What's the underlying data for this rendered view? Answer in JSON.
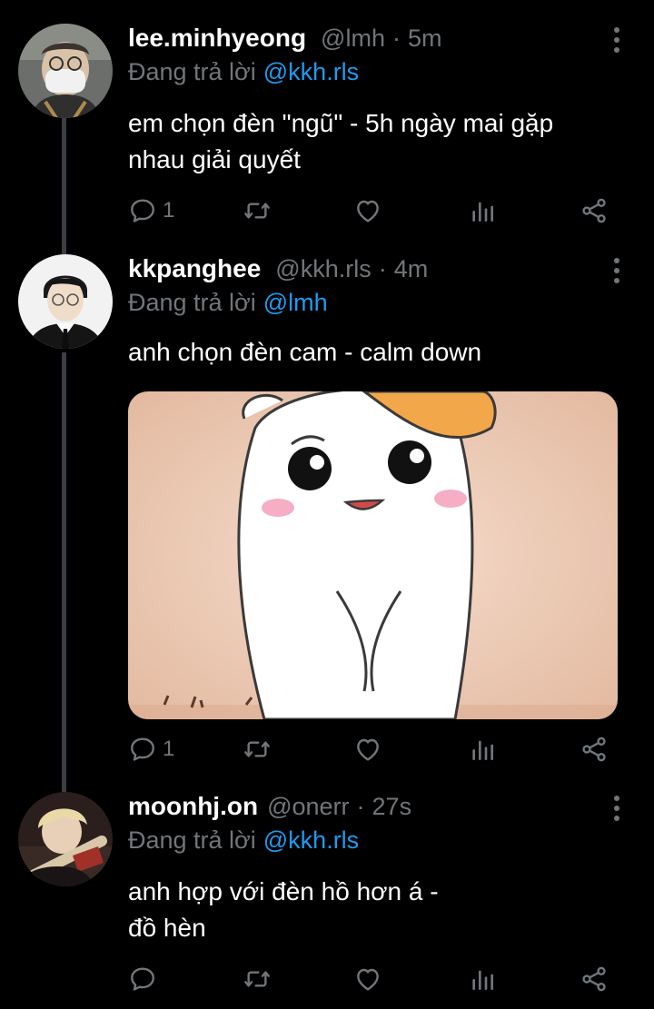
{
  "theme": {
    "background": "#000000",
    "accent": "#1d9bf0",
    "muted": "#71767b",
    "thread_line": "#3b3f44"
  },
  "tweets": [
    {
      "display_name": "lee.minhyeong",
      "handle": "@lmh",
      "separator": "·",
      "time": "5m",
      "reply_prefix": "Đang trả lời",
      "reply_to": "@kkh.rls",
      "text_lines": [
        "em chọn đèn \"ngũ\" - 5h ngày mai gặp",
        "nhau giải quyết"
      ],
      "reply_count": "1",
      "avatar_icon": "profile-photo-masked-man",
      "has_media": false
    },
    {
      "display_name": "kkpanghee",
      "handle": "@kkh.rls",
      "separator": "·",
      "time": "4m",
      "reply_prefix": "Đang trả lời",
      "reply_to": "@lmh",
      "text_lines": [
        "anh chọn đèn cam - calm down"
      ],
      "reply_count": "1",
      "avatar_icon": "profile-photo-suit-man",
      "has_media": true,
      "media_icon": "cartoon-hamster-image"
    },
    {
      "display_name": "moonhj.on",
      "handle": "@onerr",
      "separator": "·",
      "time": "27s",
      "reply_prefix": "Đang trả lời",
      "reply_to": "@kkh.rls",
      "text_lines": [
        "anh hợp với đèn hồ hơn á -",
        "đồ hèn"
      ],
      "reply_count": "",
      "avatar_icon": "profile-photo-blonde-man",
      "has_media": false
    }
  ],
  "action_icons": [
    "reply-icon",
    "retweet-icon",
    "like-icon",
    "analytics-icon",
    "share-icon"
  ]
}
